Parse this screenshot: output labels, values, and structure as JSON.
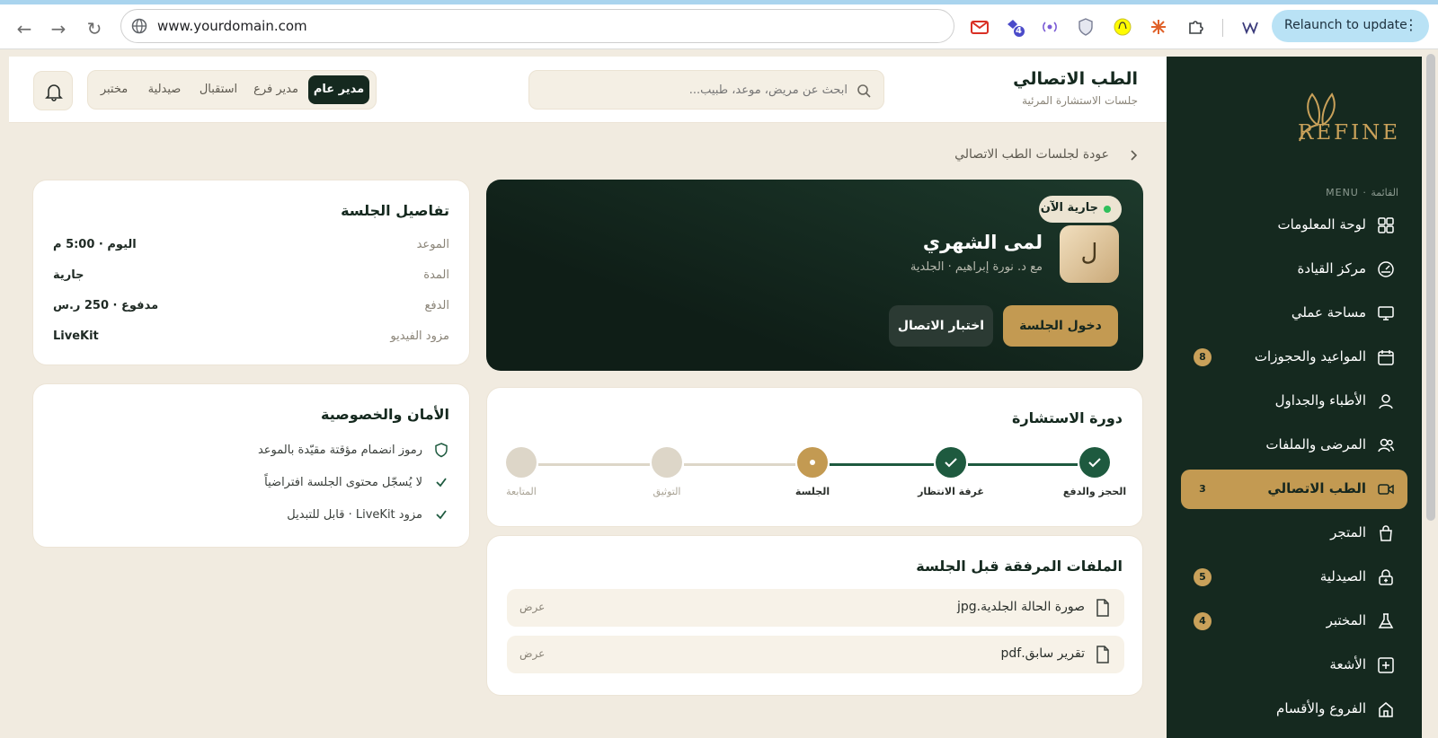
{
  "browser": {
    "url": "www.yourdomain.com",
    "relaunch_label": "Relaunch to update",
    "extension_badge": "4"
  },
  "sidebar": {
    "logo_text": "REFINE",
    "menu_label": "MENU · القائمة",
    "items": [
      {
        "label": "لوحة المعلومات",
        "icon": "dashboard-icon",
        "badge": ""
      },
      {
        "label": "مركز القيادة",
        "icon": "gauge-icon",
        "badge": ""
      },
      {
        "label": "مساحة عملي",
        "icon": "monitor-icon",
        "badge": ""
      },
      {
        "label": "المواعيد والحجوزات",
        "icon": "calendar-icon",
        "badge": "8"
      },
      {
        "label": "الأطباء والجداول",
        "icon": "user-icon",
        "badge": ""
      },
      {
        "label": "المرضى والملفات",
        "icon": "users-icon",
        "badge": ""
      },
      {
        "label": "الطب الاتصالي",
        "icon": "video-icon",
        "badge": "3"
      },
      {
        "label": "المتجر",
        "icon": "bag-icon",
        "badge": ""
      },
      {
        "label": "الصيدلية",
        "icon": "lock-plus-icon",
        "badge": "5"
      },
      {
        "label": "المختبر",
        "icon": "flask-icon",
        "badge": "4"
      },
      {
        "label": "الأشعة",
        "icon": "plus-box-icon",
        "badge": ""
      },
      {
        "label": "الفروع والأقسام",
        "icon": "home-icon",
        "badge": ""
      }
    ],
    "active_index": 6
  },
  "header": {
    "title": "الطب الاتصالي",
    "subtitle": "جلسات الاستشارة المرئية",
    "search_placeholder": "ابحث عن مريض، موعد، طبيب...",
    "roles": [
      "مدير عام",
      "مدير فرع",
      "استقبال",
      "صيدلية",
      "مختبر"
    ],
    "active_role": "مدير عام"
  },
  "back_link": "عودة لجلسات الطب الاتصالي",
  "session": {
    "status": "جارية الآن",
    "avatar_letter": "ل",
    "patient_name": "لمى الشهري",
    "doctor_line": "مع د. نورة إبراهيم · الجلدية",
    "enter_label": "دخول الجلسة",
    "test_label": "اختبار الاتصال"
  },
  "lifecycle": {
    "title": "دورة الاستشارة",
    "steps": [
      {
        "label": "الحجز والدفع",
        "state": "done"
      },
      {
        "label": "غرفة الانتظار",
        "state": "done"
      },
      {
        "label": "الجلسة",
        "state": "current"
      },
      {
        "label": "التوثيق",
        "state": "pending"
      },
      {
        "label": "المتابعة",
        "state": "pending"
      }
    ]
  },
  "files": {
    "title": "الملفات المرفقة قبل الجلسة",
    "view_label": "عرض",
    "items": [
      "صورة الحالة الجلدية.jpg",
      "تقرير سابق.pdf"
    ]
  },
  "details": {
    "title": "تفاصيل الجلسة",
    "rows": [
      {
        "key": "الموعد",
        "value": "اليوم · 5:00 م"
      },
      {
        "key": "المدة",
        "value": "جارية"
      },
      {
        "key": "الدفع",
        "value": "مدفوع · 250 ر.س"
      },
      {
        "key": "مزود الفيديو",
        "value": "LiveKit"
      }
    ]
  },
  "security": {
    "title": "الأمان والخصوصية",
    "items": [
      {
        "text": "رموز انضمام مؤقتة مقيّدة بالموعد",
        "icon": "shield-icon"
      },
      {
        "text": "لا يُسجّل محتوى الجلسة افتراضياً",
        "icon": "check-icon"
      },
      {
        "text": "مزود LiveKit · قابل للتبديل",
        "icon": "check-icon"
      }
    ]
  },
  "colors": {
    "sidebar": "#15291f",
    "accent": "#c39a52",
    "done": "#1e5a3f",
    "pending": "#ddd6c8",
    "background": "#f1ebe0"
  }
}
